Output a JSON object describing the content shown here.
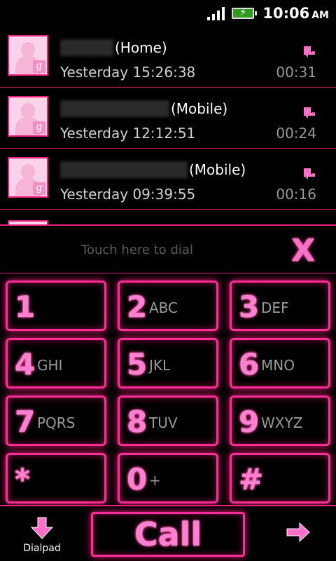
{
  "status": {
    "time": "10:06",
    "ampm": "AM"
  },
  "call_log": [
    {
      "type_label": "(Home)",
      "time": "Yesterday 15:26:38",
      "duration": "00:31",
      "blur_width": 76
    },
    {
      "type_label": "(Mobile)",
      "time": "Yesterday 12:12:51",
      "duration": "00:24",
      "blur_width": 156
    },
    {
      "type_label": "(Mobile)",
      "time": "Yesterday 09:39:55",
      "duration": "00:16",
      "blur_width": 182
    }
  ],
  "dial": {
    "placeholder": "Touch here to dial",
    "backspace": "X"
  },
  "keys": [
    {
      "digit": "1",
      "letters": ""
    },
    {
      "digit": "2",
      "letters": "ABC"
    },
    {
      "digit": "3",
      "letters": "DEF"
    },
    {
      "digit": "4",
      "letters": "GHI"
    },
    {
      "digit": "5",
      "letters": "JKL"
    },
    {
      "digit": "6",
      "letters": "MNO"
    },
    {
      "digit": "7",
      "letters": "PQRS"
    },
    {
      "digit": "8",
      "letters": "TUV"
    },
    {
      "digit": "9",
      "letters": "WXYZ"
    },
    {
      "digit": "*",
      "letters": ""
    },
    {
      "digit": "0",
      "letters": "+"
    },
    {
      "digit": "#",
      "letters": ""
    }
  ],
  "bottom": {
    "dialpad_label": "Dialpad",
    "call_label": "Call"
  },
  "colors": {
    "accent": "#ff2d95",
    "accent_glow": "#ff7fd0",
    "avatar_bg": "#fbd3e8"
  },
  "icons": {
    "signal": "signal-icon",
    "battery": "battery-icon",
    "incoming": "incoming-call-icon",
    "dialpad": "down-arrow-icon",
    "next": "right-arrow-icon"
  }
}
